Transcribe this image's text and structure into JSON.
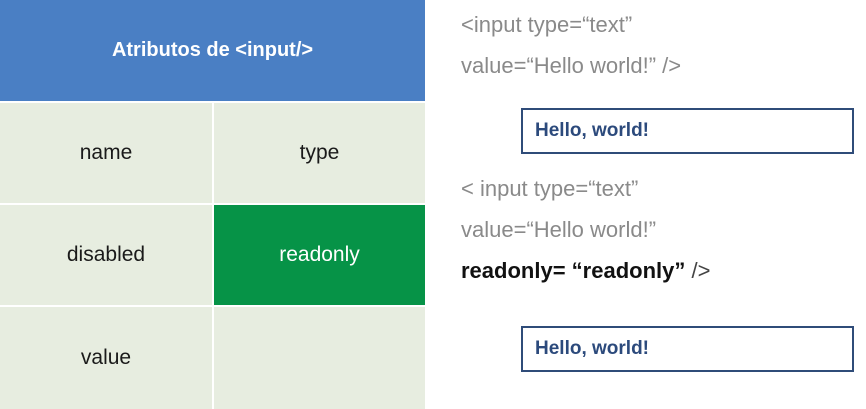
{
  "table": {
    "header": "Atributos de <input/>",
    "rows": [
      [
        "name",
        "type"
      ],
      [
        "disabled",
        "readonly"
      ],
      [
        "value",
        ""
      ]
    ],
    "highlight_color": "#069347",
    "header_color": "#4a7fc4"
  },
  "code1": {
    "line1": "<input type=“text”",
    "line2": "value=“Hello world!” />"
  },
  "demo1": {
    "value": "Hello, world!"
  },
  "code2": {
    "line1": "< input type=“text”",
    "line2": "value=“Hello world!”",
    "line3_bold": "readonly= “readonly”",
    "line3_end": " />"
  },
  "demo2": {
    "value": "Hello, world!"
  }
}
